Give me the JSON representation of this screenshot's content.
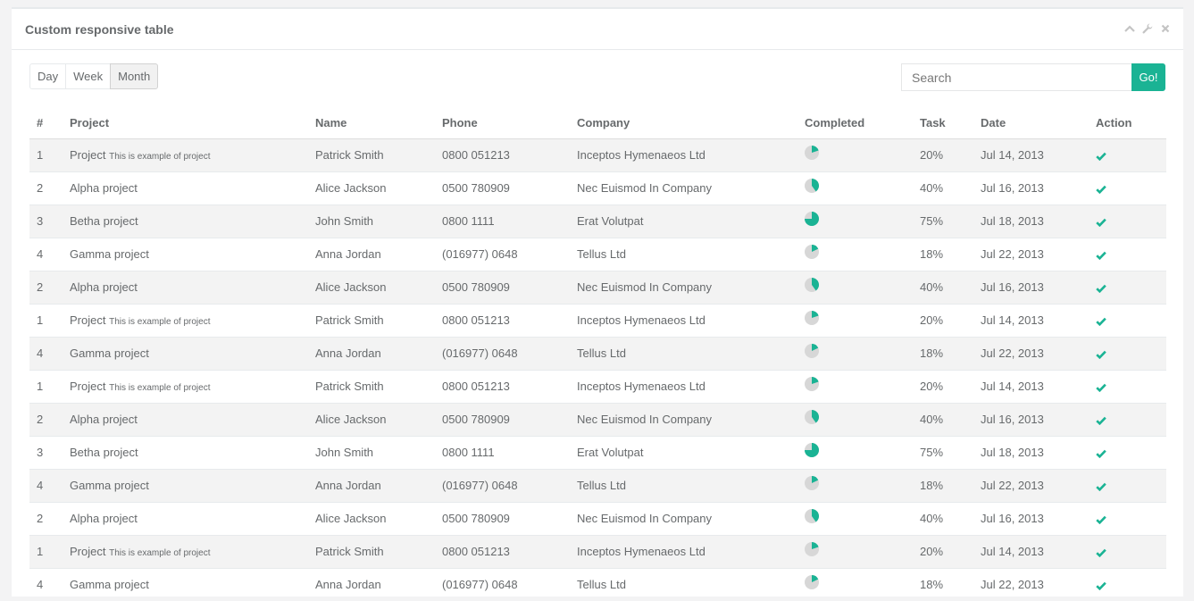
{
  "panel": {
    "title": "Custom responsive table",
    "tools": [
      "chevron-up-icon",
      "wrench-icon",
      "close-icon"
    ]
  },
  "filters": {
    "buttons": [
      "Day",
      "Week",
      "Month"
    ],
    "active": "Month"
  },
  "search": {
    "placeholder": "Search",
    "button_label": "Go!"
  },
  "colors": {
    "accent": "#1ab394",
    "pie_bg": "#d7d7d7"
  },
  "table": {
    "headers": [
      "#",
      "Project",
      "Name",
      "Phone",
      "Company",
      "Completed",
      "Task",
      "Date",
      "Action"
    ],
    "rows": [
      {
        "num": "1",
        "project": "Project",
        "note": "This is example of project",
        "name": "Patrick Smith",
        "phone": "0800 051213",
        "company": "Inceptos Hymenaeos Ltd",
        "completed": 0.2,
        "task": "20%",
        "date": "Jul 14, 2013"
      },
      {
        "num": "2",
        "project": "Alpha project",
        "note": "",
        "name": "Alice Jackson",
        "phone": "0500 780909",
        "company": "Nec Euismod In Company",
        "completed": 0.4,
        "task": "40%",
        "date": "Jul 16, 2013"
      },
      {
        "num": "3",
        "project": "Betha project",
        "note": "",
        "name": "John Smith",
        "phone": "0800 1111",
        "company": "Erat Volutpat",
        "completed": 0.75,
        "task": "75%",
        "date": "Jul 18, 2013"
      },
      {
        "num": "4",
        "project": "Gamma project",
        "note": "",
        "name": "Anna Jordan",
        "phone": "(016977) 0648",
        "company": "Tellus Ltd",
        "completed": 0.18,
        "task": "18%",
        "date": "Jul 22, 2013"
      },
      {
        "num": "2",
        "project": "Alpha project",
        "note": "",
        "name": "Alice Jackson",
        "phone": "0500 780909",
        "company": "Nec Euismod In Company",
        "completed": 0.4,
        "task": "40%",
        "date": "Jul 16, 2013"
      },
      {
        "num": "1",
        "project": "Project",
        "note": "This is example of project",
        "name": "Patrick Smith",
        "phone": "0800 051213",
        "company": "Inceptos Hymenaeos Ltd",
        "completed": 0.2,
        "task": "20%",
        "date": "Jul 14, 2013"
      },
      {
        "num": "4",
        "project": "Gamma project",
        "note": "",
        "name": "Anna Jordan",
        "phone": "(016977) 0648",
        "company": "Tellus Ltd",
        "completed": 0.18,
        "task": "18%",
        "date": "Jul 22, 2013"
      },
      {
        "num": "1",
        "project": "Project",
        "note": "This is example of project",
        "name": "Patrick Smith",
        "phone": "0800 051213",
        "company": "Inceptos Hymenaeos Ltd",
        "completed": 0.2,
        "task": "20%",
        "date": "Jul 14, 2013"
      },
      {
        "num": "2",
        "project": "Alpha project",
        "note": "",
        "name": "Alice Jackson",
        "phone": "0500 780909",
        "company": "Nec Euismod In Company",
        "completed": 0.4,
        "task": "40%",
        "date": "Jul 16, 2013"
      },
      {
        "num": "3",
        "project": "Betha project",
        "note": "",
        "name": "John Smith",
        "phone": "0800 1111",
        "company": "Erat Volutpat",
        "completed": 0.75,
        "task": "75%",
        "date": "Jul 18, 2013"
      },
      {
        "num": "4",
        "project": "Gamma project",
        "note": "",
        "name": "Anna Jordan",
        "phone": "(016977) 0648",
        "company": "Tellus Ltd",
        "completed": 0.18,
        "task": "18%",
        "date": "Jul 22, 2013"
      },
      {
        "num": "2",
        "project": "Alpha project",
        "note": "",
        "name": "Alice Jackson",
        "phone": "0500 780909",
        "company": "Nec Euismod In Company",
        "completed": 0.4,
        "task": "40%",
        "date": "Jul 16, 2013"
      },
      {
        "num": "1",
        "project": "Project",
        "note": "This is example of project",
        "name": "Patrick Smith",
        "phone": "0800 051213",
        "company": "Inceptos Hymenaeos Ltd",
        "completed": 0.2,
        "task": "20%",
        "date": "Jul 14, 2013"
      },
      {
        "num": "4",
        "project": "Gamma project",
        "note": "",
        "name": "Anna Jordan",
        "phone": "(016977) 0648",
        "company": "Tellus Ltd",
        "completed": 0.18,
        "task": "18%",
        "date": "Jul 22, 2013"
      }
    ]
  }
}
